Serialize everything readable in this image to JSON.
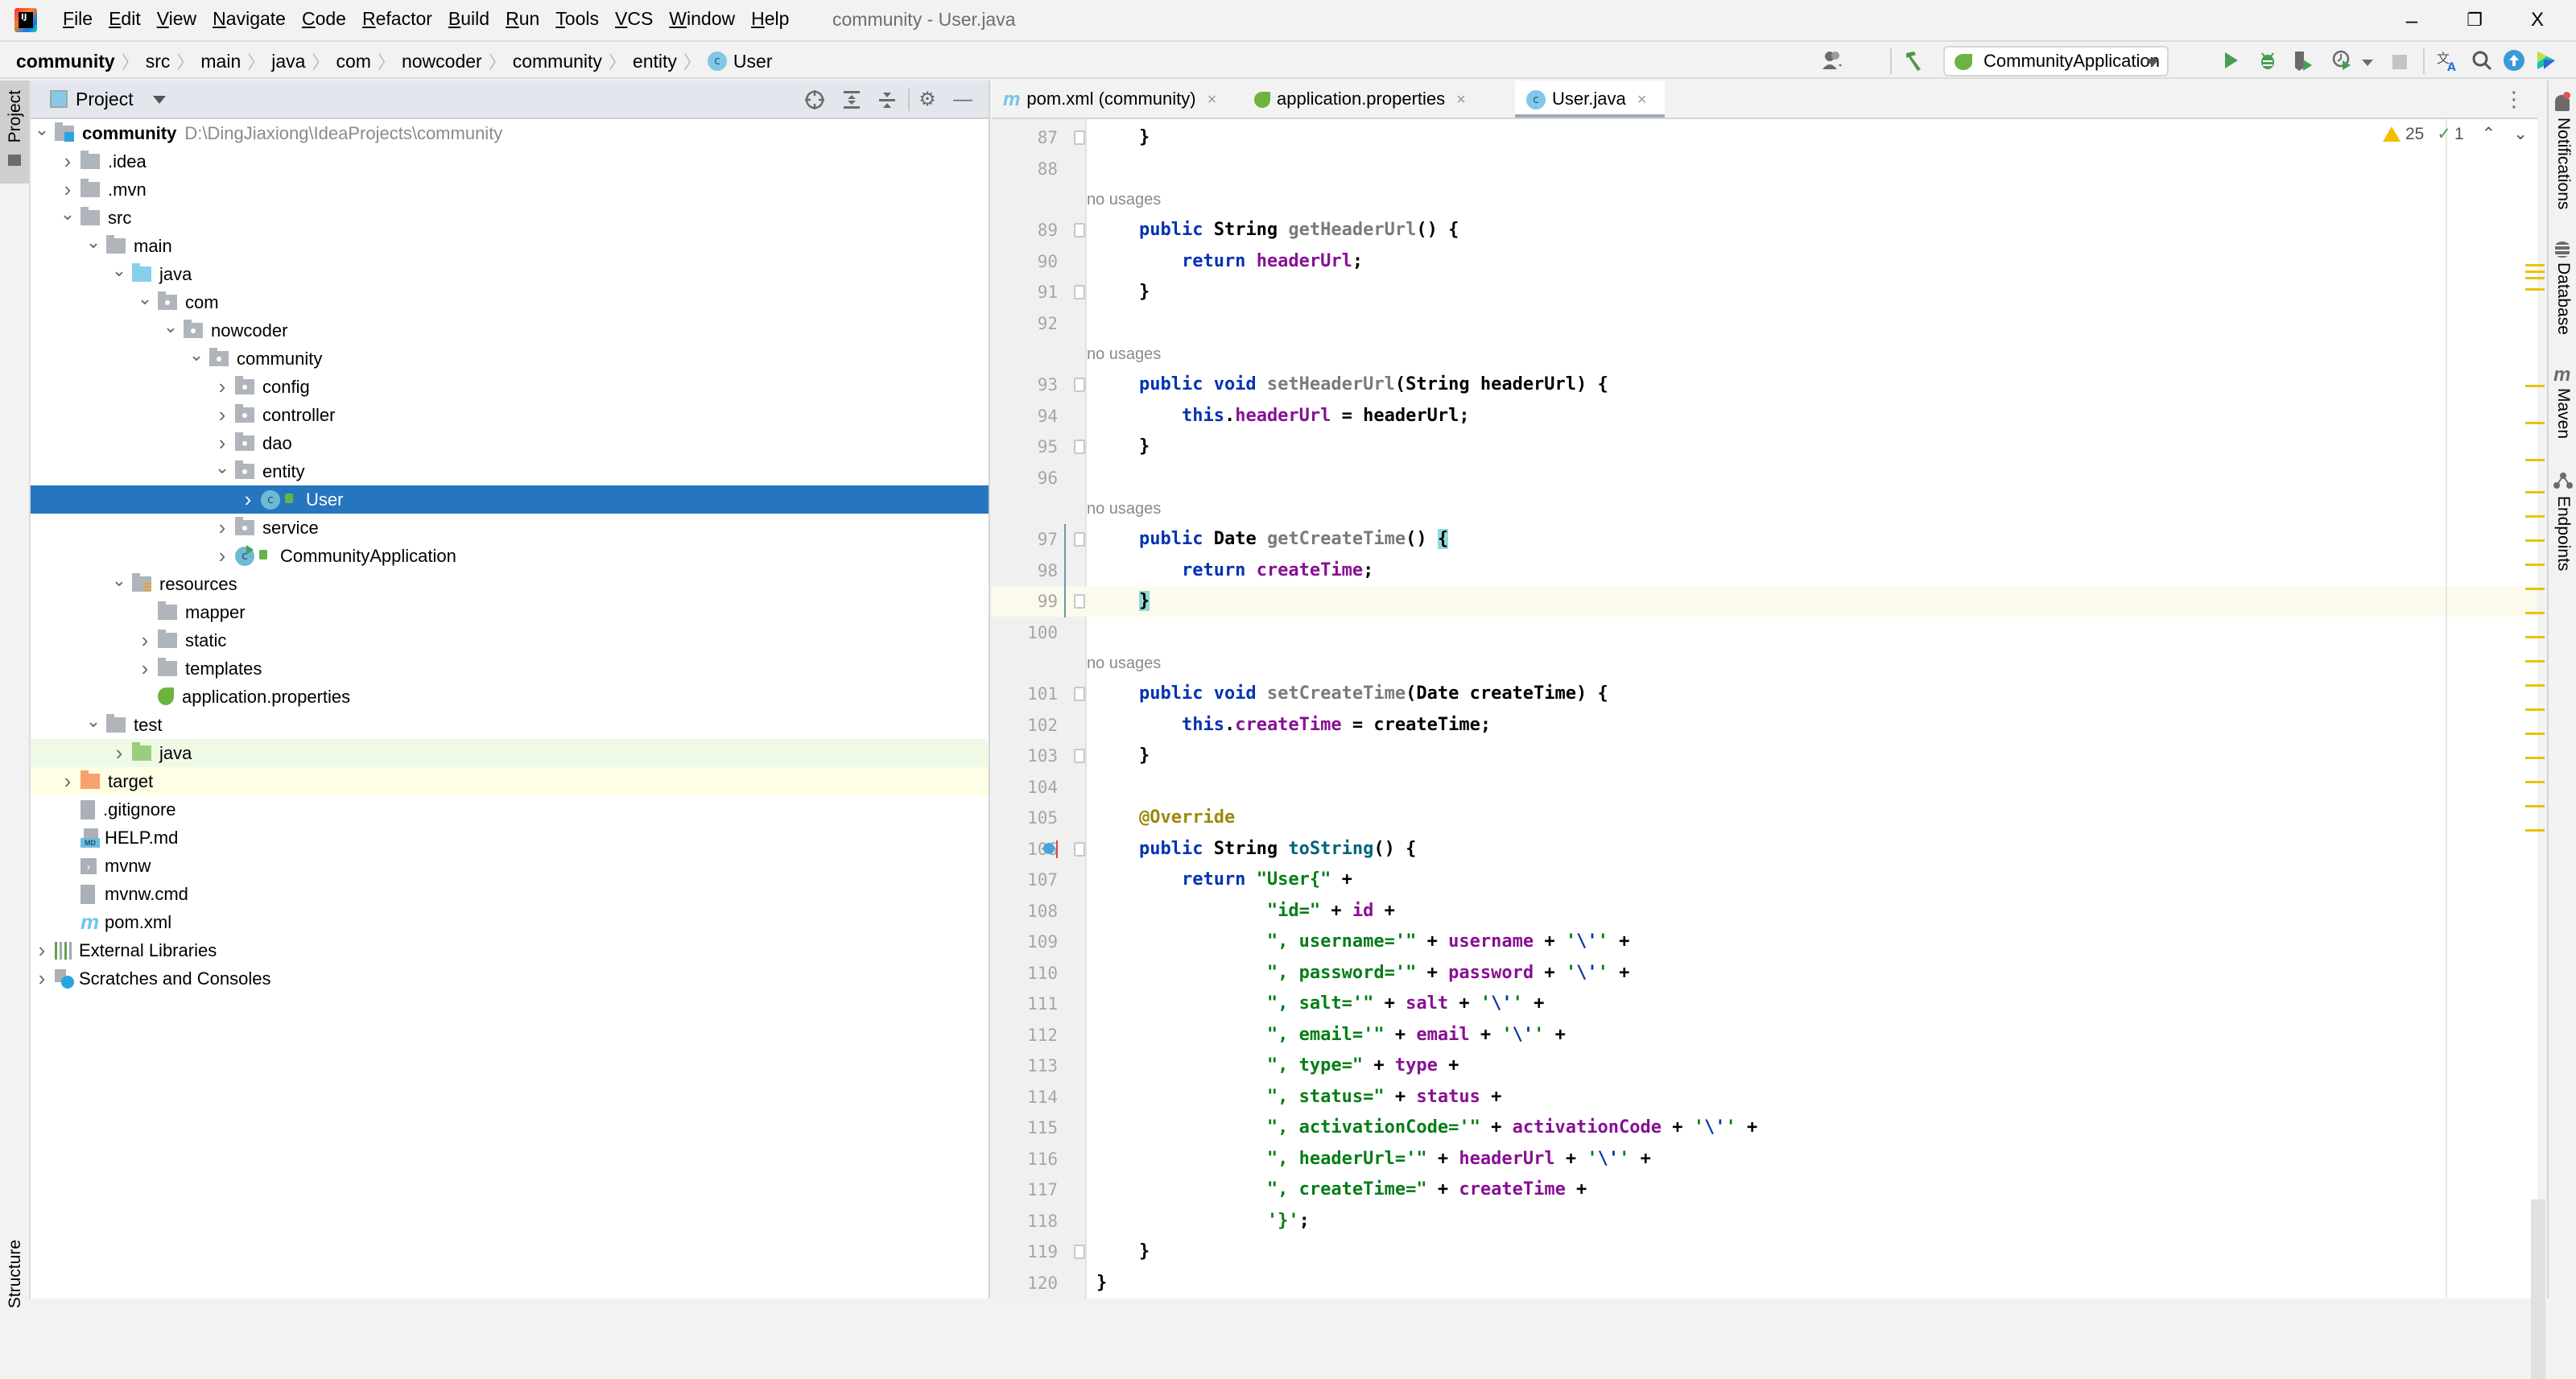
{
  "window": {
    "title": "community - User.java",
    "controls": {
      "minimize": "–",
      "restore": "❐",
      "close": "X"
    }
  },
  "menu": [
    "File",
    "Edit",
    "View",
    "Navigate",
    "Code",
    "Refactor",
    "Build",
    "Run",
    "Tools",
    "VCS",
    "Window",
    "Help"
  ],
  "breadcrumb": [
    "community",
    "src",
    "main",
    "java",
    "com",
    "nowcoder",
    "community",
    "entity",
    "User"
  ],
  "toolbar": {
    "run_config": "CommunityApplication",
    "icons": [
      "user-icon",
      "build-hammer-icon",
      "run-icon",
      "debug-icon",
      "coverage-icon",
      "profile-icon",
      "stop-icon",
      "translate-icon",
      "search-icon",
      "update-icon",
      "code-with-me-icon"
    ]
  },
  "left_stripe": {
    "top": "Project",
    "bottom": "Structure"
  },
  "right_stripe": [
    "Notifications",
    "Database",
    "Maven",
    "Endpoints"
  ],
  "project_panel": {
    "title": "Project",
    "tree": [
      {
        "label": "community",
        "path": "D:\\DingJiaxiong\\IdeaProjects\\community",
        "depth": 0,
        "chevron": "down",
        "icon": "module-folder",
        "bold": true
      },
      {
        "label": ".idea",
        "depth": 1,
        "chevron": "right",
        "icon": "folder"
      },
      {
        "label": ".mvn",
        "depth": 1,
        "chevron": "right",
        "icon": "folder"
      },
      {
        "label": "src",
        "depth": 1,
        "chevron": "down",
        "icon": "folder"
      },
      {
        "label": "main",
        "depth": 2,
        "chevron": "down",
        "icon": "folder"
      },
      {
        "label": "java",
        "depth": 3,
        "chevron": "down",
        "icon": "source-folder"
      },
      {
        "label": "com",
        "depth": 4,
        "chevron": "down",
        "icon": "package"
      },
      {
        "label": "nowcoder",
        "depth": 5,
        "chevron": "down",
        "icon": "package"
      },
      {
        "label": "community",
        "depth": 6,
        "chevron": "down",
        "icon": "package"
      },
      {
        "label": "config",
        "depth": 7,
        "chevron": "right",
        "icon": "package"
      },
      {
        "label": "controller",
        "depth": 7,
        "chevron": "right",
        "icon": "package"
      },
      {
        "label": "dao",
        "depth": 7,
        "chevron": "right",
        "icon": "package"
      },
      {
        "label": "entity",
        "depth": 7,
        "chevron": "down",
        "icon": "package"
      },
      {
        "label": "User",
        "depth": 8,
        "chevron": "right",
        "icon": "class",
        "selected": true
      },
      {
        "label": "service",
        "depth": 7,
        "chevron": "right",
        "icon": "package"
      },
      {
        "label": "CommunityApplication",
        "depth": 7,
        "chevron": "right",
        "icon": "spring-class"
      },
      {
        "label": "resources",
        "depth": 3,
        "chevron": "down",
        "icon": "resources-folder"
      },
      {
        "label": "mapper",
        "depth": 4,
        "chevron": "",
        "icon": "folder"
      },
      {
        "label": "static",
        "depth": 4,
        "chevron": "right",
        "icon": "folder"
      },
      {
        "label": "templates",
        "depth": 4,
        "chevron": "right",
        "icon": "folder"
      },
      {
        "label": "application.properties",
        "depth": 4,
        "chevron": "",
        "icon": "spring-properties"
      },
      {
        "label": "test",
        "depth": 2,
        "chevron": "down",
        "icon": "folder"
      },
      {
        "label": "java",
        "depth": 3,
        "chevron": "right",
        "icon": "test-folder",
        "highlight": "green"
      },
      {
        "label": "target",
        "depth": 1,
        "chevron": "right",
        "icon": "excluded-folder",
        "highlight": "yellow"
      },
      {
        "label": ".gitignore",
        "depth": 1,
        "chevron": "",
        "icon": "ignore-file"
      },
      {
        "label": "HELP.md",
        "depth": 1,
        "chevron": "",
        "icon": "markdown-file"
      },
      {
        "label": "mvnw",
        "depth": 1,
        "chevron": "",
        "icon": "shell-file"
      },
      {
        "label": "mvnw.cmd",
        "depth": 1,
        "chevron": "",
        "icon": "text-file"
      },
      {
        "label": "pom.xml",
        "depth": 1,
        "chevron": "",
        "icon": "maven-file"
      },
      {
        "label": "External Libraries",
        "depth": 0,
        "chevron": "right",
        "icon": "libraries"
      },
      {
        "label": "Scratches and Consoles",
        "depth": 0,
        "chevron": "right",
        "icon": "scratches"
      }
    ]
  },
  "editor": {
    "tabs": [
      {
        "label": "pom.xml (community)",
        "icon": "maven-icon",
        "active": false
      },
      {
        "label": "application.properties",
        "icon": "spring-icon",
        "active": false
      },
      {
        "label": "User.java",
        "icon": "class-icon",
        "active": true
      }
    ],
    "inspections": {
      "warnings": "25",
      "weak_warnings": "1"
    },
    "current_line": 99,
    "lines": [
      {
        "n": 87,
        "tokens": [
          [
            "pn",
            "    }"
          ]
        ]
      },
      {
        "n": 88,
        "tokens": []
      },
      {
        "hint": "no usages"
      },
      {
        "n": 89,
        "tokens": [
          [
            "kw",
            "    public "
          ],
          [
            "ty",
            "String "
          ],
          [
            "fn",
            "getHeaderUrl"
          ],
          [
            "pn",
            "() {"
          ]
        ]
      },
      {
        "n": 90,
        "tokens": [
          [
            "kw",
            "        return "
          ],
          [
            "fld",
            "headerUrl"
          ],
          [
            "pn",
            ";"
          ]
        ]
      },
      {
        "n": 91,
        "tokens": [
          [
            "pn",
            "    }"
          ]
        ]
      },
      {
        "n": 92,
        "tokens": []
      },
      {
        "hint": "no usages"
      },
      {
        "n": 93,
        "tokens": [
          [
            "kw",
            "    public void "
          ],
          [
            "fn",
            "setHeaderUrl"
          ],
          [
            "pn",
            "(String headerUrl) {"
          ]
        ]
      },
      {
        "n": 94,
        "tokens": [
          [
            "kw",
            "        this"
          ],
          [
            "pn",
            "."
          ],
          [
            "fld",
            "headerUrl"
          ],
          [
            "pn",
            " = headerUrl;"
          ]
        ]
      },
      {
        "n": 95,
        "tokens": [
          [
            "pn",
            "    }"
          ]
        ]
      },
      {
        "n": 96,
        "tokens": []
      },
      {
        "hint": "no usages"
      },
      {
        "n": 97,
        "tokens": [
          [
            "kw",
            "    public "
          ],
          [
            "ty",
            "Date "
          ],
          [
            "fn",
            "getCreateTime"
          ],
          [
            "pn",
            "() "
          ],
          [
            "hl",
            "{"
          ]
        ]
      },
      {
        "n": 98,
        "tokens": [
          [
            "kw",
            "        return "
          ],
          [
            "fld",
            "createTime"
          ],
          [
            "pn",
            ";"
          ]
        ]
      },
      {
        "n": 99,
        "tokens": [
          [
            "pn",
            "    "
          ],
          [
            "hl",
            "}"
          ]
        ]
      },
      {
        "n": 100,
        "tokens": []
      },
      {
        "hint": "no usages"
      },
      {
        "n": 101,
        "tokens": [
          [
            "kw",
            "    public void "
          ],
          [
            "fn",
            "setCreateTime"
          ],
          [
            "pn",
            "(Date createTime) {"
          ]
        ]
      },
      {
        "n": 102,
        "tokens": [
          [
            "kw",
            "        this"
          ],
          [
            "pn",
            "."
          ],
          [
            "fld",
            "createTime"
          ],
          [
            "pn",
            " = createTime;"
          ]
        ]
      },
      {
        "n": 103,
        "tokens": [
          [
            "pn",
            "    }"
          ]
        ]
      },
      {
        "n": 104,
        "tokens": []
      },
      {
        "n": 105,
        "tokens": [
          [
            "ann",
            "    @Override"
          ]
        ]
      },
      {
        "n": 106,
        "tokens": [
          [
            "kw",
            "    public "
          ],
          [
            "ty",
            "String "
          ],
          [
            "fnd",
            "toString"
          ],
          [
            "pn",
            "() {"
          ]
        ]
      },
      {
        "n": 107,
        "tokens": [
          [
            "kw",
            "        return "
          ],
          [
            "str",
            "\"User{\""
          ],
          [
            "pn",
            " +"
          ]
        ]
      },
      {
        "n": 108,
        "tokens": [
          [
            "str",
            "                \"id=\""
          ],
          [
            "pn",
            " + "
          ],
          [
            "fld",
            "id"
          ],
          [
            "pn",
            " +"
          ]
        ]
      },
      {
        "n": 109,
        "tokens": [
          [
            "str",
            "                \", username='\""
          ],
          [
            "pn",
            " + "
          ],
          [
            "fld",
            "username"
          ],
          [
            "pn",
            " + "
          ],
          [
            "str",
            "'"
          ],
          [
            "esc",
            "\\'"
          ],
          [
            "str",
            "'"
          ],
          [
            "pn",
            " +"
          ]
        ]
      },
      {
        "n": 110,
        "tokens": [
          [
            "str",
            "                \", password='\""
          ],
          [
            "pn",
            " + "
          ],
          [
            "fld",
            "password"
          ],
          [
            "pn",
            " + "
          ],
          [
            "str",
            "'"
          ],
          [
            "esc",
            "\\'"
          ],
          [
            "str",
            "'"
          ],
          [
            "pn",
            " +"
          ]
        ]
      },
      {
        "n": 111,
        "tokens": [
          [
            "str",
            "                \", salt='\""
          ],
          [
            "pn",
            " + "
          ],
          [
            "fld",
            "salt"
          ],
          [
            "pn",
            " + "
          ],
          [
            "str",
            "'"
          ],
          [
            "esc",
            "\\'"
          ],
          [
            "str",
            "'"
          ],
          [
            "pn",
            " +"
          ]
        ]
      },
      {
        "n": 112,
        "tokens": [
          [
            "str",
            "                \", email='\""
          ],
          [
            "pn",
            " + "
          ],
          [
            "fld",
            "email"
          ],
          [
            "pn",
            " + "
          ],
          [
            "str",
            "'"
          ],
          [
            "esc",
            "\\'"
          ],
          [
            "str",
            "'"
          ],
          [
            "pn",
            " +"
          ]
        ]
      },
      {
        "n": 113,
        "tokens": [
          [
            "str",
            "                \", type=\""
          ],
          [
            "pn",
            " + "
          ],
          [
            "fld",
            "type"
          ],
          [
            "pn",
            " +"
          ]
        ]
      },
      {
        "n": 114,
        "tokens": [
          [
            "str",
            "                \", status=\""
          ],
          [
            "pn",
            " + "
          ],
          [
            "fld",
            "status"
          ],
          [
            "pn",
            " +"
          ]
        ]
      },
      {
        "n": 115,
        "tokens": [
          [
            "str",
            "                \", activationCode='\""
          ],
          [
            "pn",
            " + "
          ],
          [
            "fld",
            "activationCode"
          ],
          [
            "pn",
            " + "
          ],
          [
            "str",
            "'"
          ],
          [
            "esc",
            "\\'"
          ],
          [
            "str",
            "'"
          ],
          [
            "pn",
            " +"
          ]
        ]
      },
      {
        "n": 116,
        "tokens": [
          [
            "str",
            "                \", headerUrl='\""
          ],
          [
            "pn",
            " + "
          ],
          [
            "fld",
            "headerUrl"
          ],
          [
            "pn",
            " + "
          ],
          [
            "str",
            "'"
          ],
          [
            "esc",
            "\\'"
          ],
          [
            "str",
            "'"
          ],
          [
            "pn",
            " +"
          ]
        ]
      },
      {
        "n": 117,
        "tokens": [
          [
            "str",
            "                \", createTime=\""
          ],
          [
            "pn",
            " + "
          ],
          [
            "fld",
            "createTime"
          ],
          [
            "pn",
            " +"
          ]
        ]
      },
      {
        "n": 118,
        "tokens": [
          [
            "str",
            "                '}'"
          ],
          [
            "pn",
            ";"
          ]
        ]
      },
      {
        "n": 119,
        "tokens": [
          [
            "pn",
            "    }"
          ]
        ]
      },
      {
        "n": 120,
        "tokens": [
          [
            "pn",
            "}"
          ]
        ]
      }
    ]
  }
}
